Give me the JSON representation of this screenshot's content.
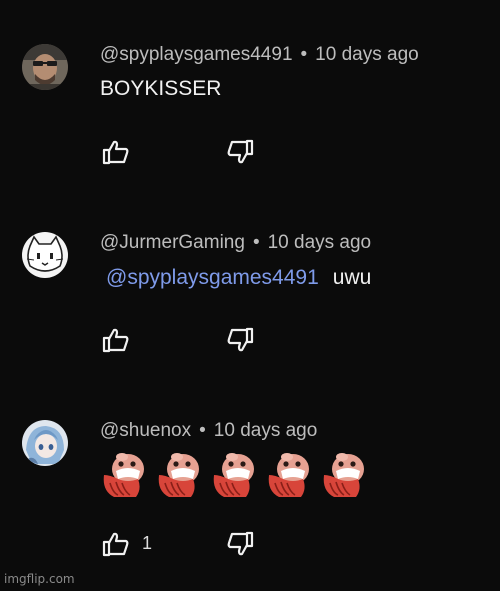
{
  "comments": [
    {
      "author": "@spyplaysgames4491",
      "time": "10 days ago",
      "text": "BOYKISSER",
      "avatar": "photo-avatar-icon"
    },
    {
      "author": "@JurmerGaming",
      "time": "10 days ago",
      "mention": "@spyplaysgames4491",
      "text": "uwu",
      "avatar": "cat-drawing-avatar-icon"
    },
    {
      "author": "@shuenox",
      "time": "10 days ago",
      "emoji_count": 5,
      "like_count": "1",
      "avatar": "anime-girl-avatar-icon"
    }
  ],
  "separator": "•",
  "watermark": "imgflip.com",
  "colors": {
    "background": "#0b0b0b",
    "mention": "#7f9bea",
    "meta_text": "#bdbdbd",
    "emoji_red": "#d8453a"
  }
}
